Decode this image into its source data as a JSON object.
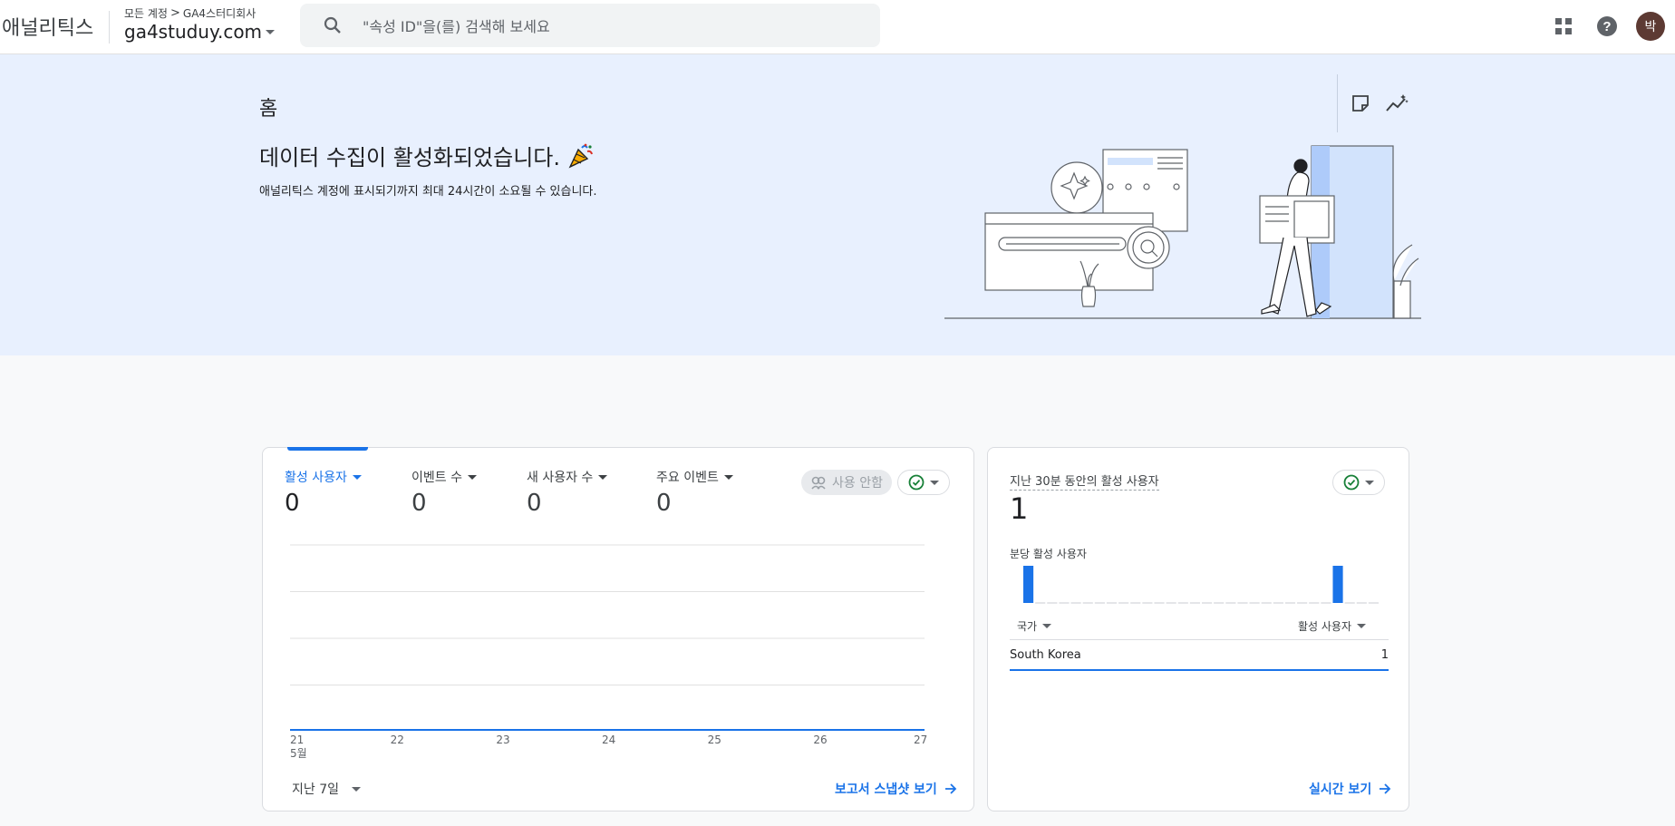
{
  "header": {
    "app_name": "애널리틱스",
    "breadcrumb": {
      "root": "모든 계정",
      "separator": ">",
      "account": "GA4스터디회사"
    },
    "property": "ga4studuy.com",
    "search_placeholder": "\"속성 ID\"을(를) 검색해 보세요",
    "icons": [
      "search-icon",
      "apps-grid-icon",
      "help-icon"
    ],
    "avatar_letter": "박"
  },
  "banner": {
    "page_title": "홈",
    "heading": "데이터 수집이 활성화되었습니다.",
    "heading_emoji": "party-popper-icon",
    "subtext": "애널리틱스 계정에 표시되기까지 최대 24시간이 소요될 수 있습니다.",
    "icons": [
      "notes-icon",
      "insights-icon"
    ]
  },
  "overview_card": {
    "metrics": [
      {
        "label": "활성 사용자",
        "value": "0",
        "active": true
      },
      {
        "label": "이벤트 수",
        "value": "0"
      },
      {
        "label": "새 사용자 수",
        "value": "0"
      },
      {
        "label": "주요 이벤트",
        "value": "0"
      }
    ],
    "disabled_chip": "사용 안함",
    "date_range": "지난 7일",
    "link": "보고서 스냅샷 보기",
    "x_month": "5월"
  },
  "chart_data": {
    "type": "line",
    "x": [
      "21",
      "22",
      "23",
      "24",
      "25",
      "26",
      "27"
    ],
    "series": [
      {
        "values": [
          0,
          0,
          0,
          0,
          0,
          0,
          0
        ]
      }
    ],
    "colors": {
      "line": "#1a73e8",
      "grid": "#e0e0e0"
    }
  },
  "realtime_card": {
    "title": "지난 30분 동안의 활성 사용자",
    "value": "1",
    "per_minute_label": "분당 활성 사용자",
    "per_minute_values": [
      1,
      0,
      0,
      0,
      0,
      0,
      0,
      0,
      0,
      0,
      0,
      0,
      0,
      0,
      0,
      0,
      0,
      0,
      0,
      0,
      0,
      0,
      0,
      0,
      0,
      0,
      1,
      0,
      0,
      0
    ],
    "table": {
      "col_country": "국가",
      "col_users": "활성 사용자",
      "rows": [
        {
          "country": "South Korea",
          "users": "1"
        }
      ]
    },
    "link": "실시간 보기"
  },
  "colors": {
    "accent": "#1a73e8",
    "banner_bg": "#e8f0fe",
    "success": "#188038"
  }
}
